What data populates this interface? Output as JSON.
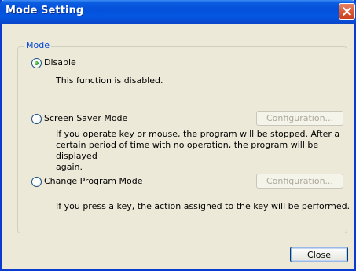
{
  "window": {
    "title": "Mode Setting",
    "close_icon": "close-icon"
  },
  "group": {
    "legend": "Mode"
  },
  "modes": [
    {
      "label": "Disable",
      "selected": true,
      "description": "This function is disabled."
    },
    {
      "label": "Screen Saver Mode",
      "selected": false,
      "config_label": "Configuration...",
      "config_enabled": false,
      "description_lines": [
        "If you operate key or mouse, the program will be stopped. After a",
        "certain period of time with no operation, the program will be displayed",
        "again."
      ]
    },
    {
      "label": "Change Program Mode",
      "selected": false,
      "config_label": "Configuration...",
      "config_enabled": false,
      "description": "If you press a key, the action assigned to the key will be performed."
    }
  ],
  "footer": {
    "close_label": "Close"
  },
  "colors": {
    "title_bar": "#0550d9",
    "legend_text": "#0046d5",
    "dialog_bg": "#ece9d8",
    "close_button": "#dc5a35"
  }
}
